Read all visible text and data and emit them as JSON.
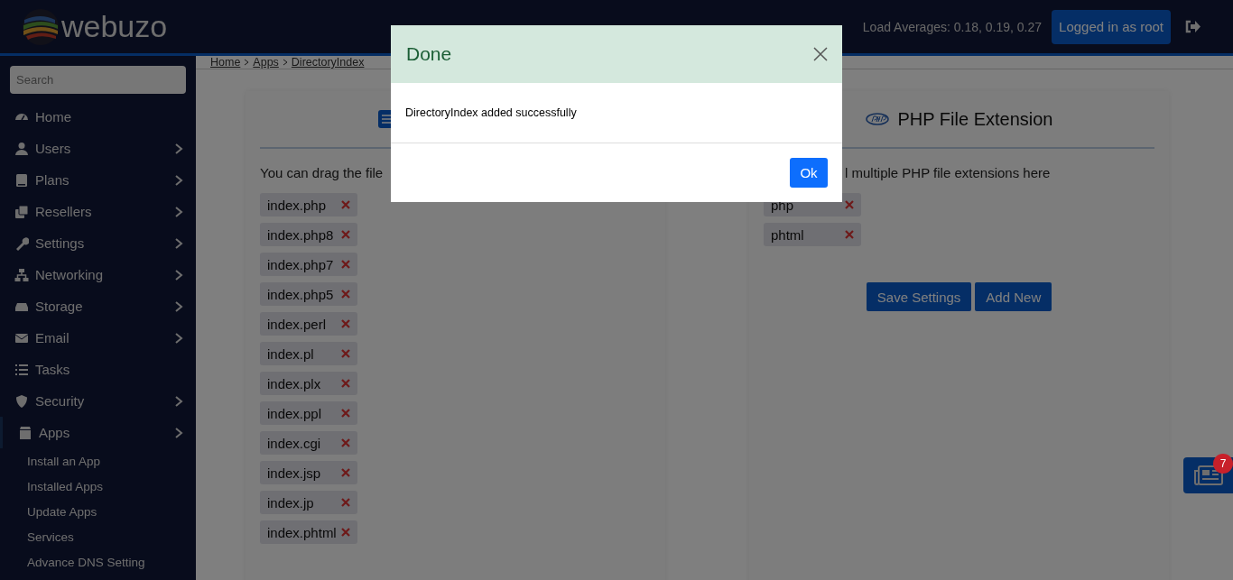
{
  "header": {
    "logo": "webuzo",
    "load_averages": "Load Averages: 0.18, 0.19, 0.27",
    "user_button": "Logged in as root"
  },
  "sidebar": {
    "search": {
      "placeholder": "Search"
    },
    "items": [
      {
        "label": "Home",
        "submenu": false,
        "expanded": false
      },
      {
        "label": "Users",
        "submenu": true,
        "expanded": false
      },
      {
        "label": "Plans",
        "submenu": true,
        "expanded": false
      },
      {
        "label": "Resellers",
        "submenu": true,
        "expanded": false
      },
      {
        "label": "Settings",
        "submenu": true,
        "expanded": false
      },
      {
        "label": "Networking",
        "submenu": true,
        "expanded": false
      },
      {
        "label": "Storage",
        "submenu": true,
        "expanded": false
      },
      {
        "label": "Email",
        "submenu": true,
        "expanded": false
      },
      {
        "label": "Tasks",
        "submenu": false,
        "expanded": false
      },
      {
        "label": "Security",
        "submenu": true,
        "expanded": false
      },
      {
        "label": "Apps",
        "submenu": true,
        "expanded": true,
        "children": [
          "Install an App",
          "Installed Apps",
          "Update Apps",
          "Services",
          "Advance DNS Setting"
        ]
      }
    ]
  },
  "breadcrumb": [
    "Home",
    "Apps",
    "DirectoryIndex"
  ],
  "cards": [
    {
      "text": "You can drag the file",
      "tags": [
        "index.php",
        "index.php8",
        "index.php7",
        "index.php5",
        "index.perl",
        "index.pl",
        "index.plx",
        "index.ppl",
        "index.cgi",
        "index.jsp",
        "index.jp",
        "index.phtml"
      ]
    },
    {
      "title": "PHP File Extension",
      "text": "l multiple PHP file extensions here",
      "tags": [
        "php",
        "phtml"
      ],
      "buttons": [
        "Save Settings",
        "Add New"
      ]
    }
  ],
  "news_badge": "7",
  "dialog": {
    "title": "Done",
    "message": "DirectoryIndex added successfully",
    "button": "Ok"
  }
}
